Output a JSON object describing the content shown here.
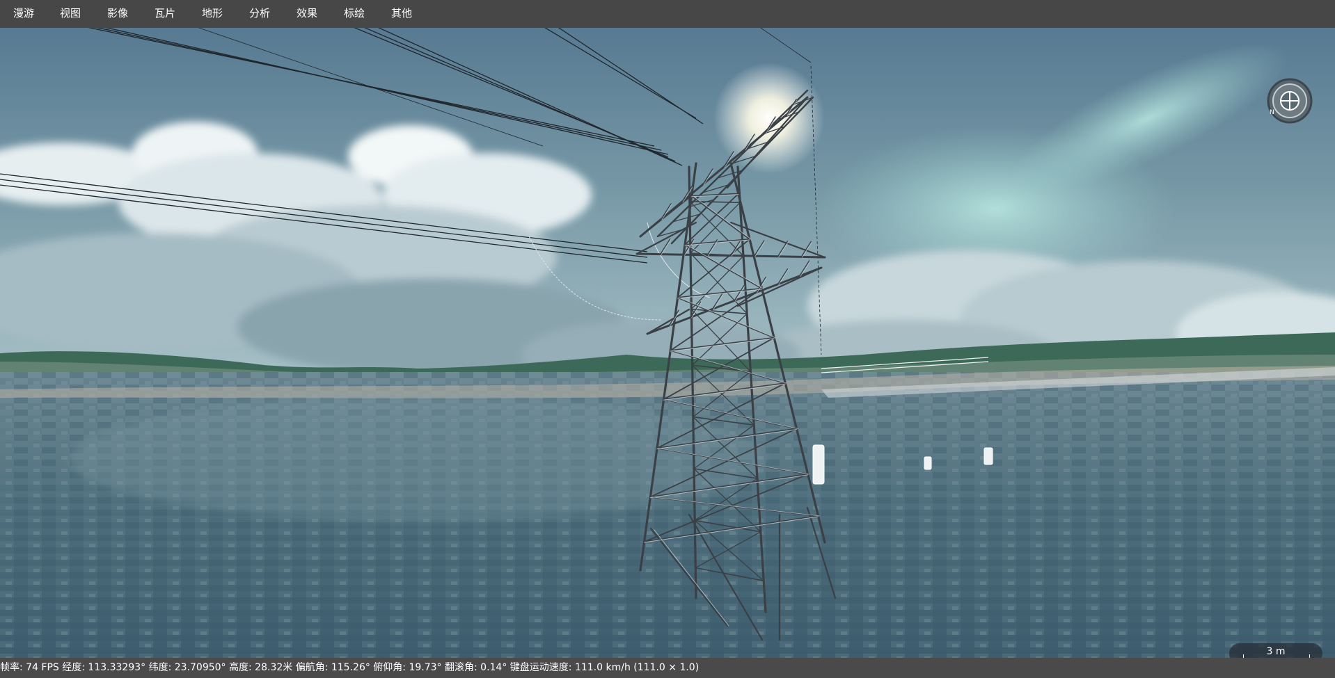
{
  "menu": {
    "items": [
      "漫游",
      "视图",
      "影像",
      "瓦片",
      "地形",
      "分析",
      "效果",
      "标绘",
      "其他"
    ]
  },
  "compass": {
    "icon": "compass-icon",
    "north_label": "N"
  },
  "scale": {
    "label": "3 m"
  },
  "status": {
    "text": "帧率: 74 FPS 经度: 113.33293° 纬度: 23.70950° 高度: 28.32米 偏航角: 115.26° 俯仰角: 19.73° 翻滚角: 0.14° 键盘运动速度: 111.0 km/h (111.0 × 1.0)"
  },
  "colors": {
    "menubar": "#474747",
    "statusbar": "#4a4a4a",
    "sky": "#5f7f94",
    "tower": "#3a4046"
  }
}
